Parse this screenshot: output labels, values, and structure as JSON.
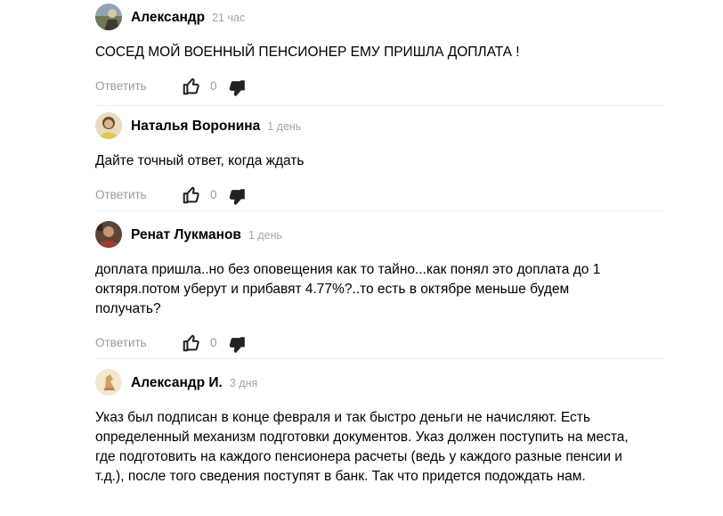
{
  "comments": [
    {
      "author": "Александр",
      "time": "21 час",
      "text": "СОСЕД МОЙ ВОЕННЫЙ ПЕНСИОНЕР ЕМУ ПРИШЛА ДОПЛАТА !",
      "reply_label": "Ответить",
      "likes": "0"
    },
    {
      "author": "Наталья Воронина",
      "time": "1 день",
      "text": "Дайте точный ответ, когда ждать",
      "reply_label": "Ответить",
      "likes": "0"
    },
    {
      "author": "Ренат Лукманов",
      "time": "1 день",
      "text": "доплата пришла..но без оповещения как то тайно...как понял это доплата до 1 октяря.потом уберут и прибавят 4.77%?..то есть в октябре меньше будем получать?",
      "reply_label": "Ответить",
      "likes": "0"
    },
    {
      "author": "Александр И.",
      "time": "3 дня",
      "text": "Указ был подписан в конце февраля и так быстро деньги не начисляют. Есть определенный механизм подготовки документов. Указ должен поступить на места, где подготовить на каждого пенсионера расчеты (ведь у каждого разные пенсии и т.д.), после того сведения поступят в банк. Так что придется подождать нам."
    }
  ],
  "icons": {
    "like": "thumbs-up-icon",
    "dislike": "thumbs-down-icon"
  },
  "colors": {
    "meta_text": "#9a9a9a",
    "time_text": "#a6a6a6"
  }
}
